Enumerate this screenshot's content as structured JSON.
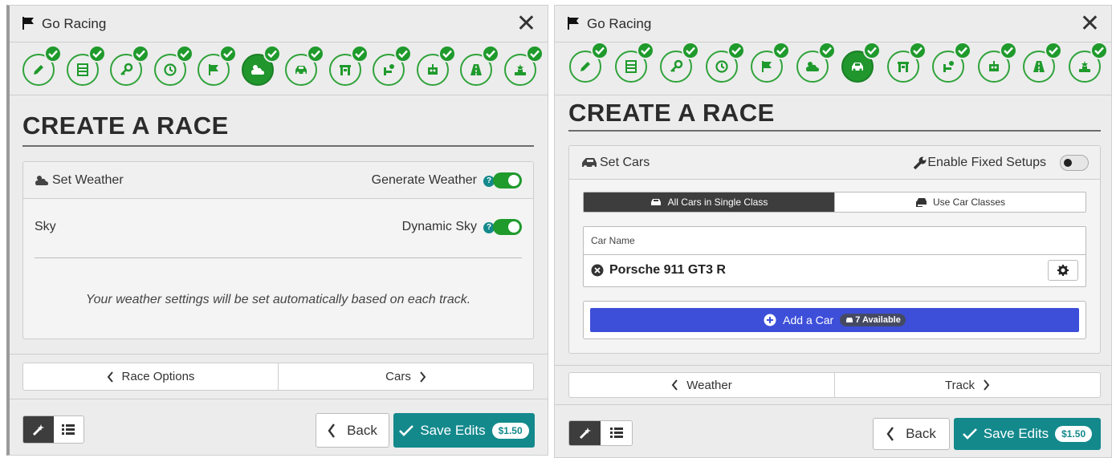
{
  "colors": {
    "accent_green": "#1f9a2c",
    "teal": "#13898c",
    "blue": "#3d4fd9",
    "dark": "#3d3d3d"
  },
  "steps": [
    "edit-icon",
    "list-icon",
    "key-icon",
    "clock-icon",
    "flag-icon",
    "weather-icon",
    "car-icon",
    "track-gate-icon",
    "driver-icon",
    "robot-icon",
    "road-icon",
    "podium-icon"
  ],
  "left": {
    "window_title": "Go Racing",
    "heading": "CREATE A RACE",
    "active_step": 5,
    "weather_card": {
      "title": "Set Weather",
      "generate_label": "Generate Weather",
      "sky_label": "Sky",
      "dynamic_label": "Dynamic Sky",
      "help_glyph": "?",
      "note": "Your weather settings will be set automatically based on each track."
    },
    "nav": {
      "prev_label": "Race Options",
      "next_label": "Cars"
    },
    "footer": {
      "back_label": "Back",
      "save_label": "Save Edits",
      "price": "$1.50"
    }
  },
  "right": {
    "window_title": "Go Racing",
    "heading": "CREATE A RACE",
    "active_step": 6,
    "cars_card": {
      "title": "Set Cars",
      "fixed_label": "Enable Fixed Setups",
      "single_class_label": "All Cars in Single Class",
      "car_classes_label": "Use Car Classes",
      "column_header": "Car Name",
      "cars": [
        "Porsche 911 GT3 R"
      ],
      "add_label": "Add a Car",
      "available": "7 Available"
    },
    "nav": {
      "prev_label": "Weather",
      "next_label": "Track"
    },
    "footer": {
      "back_label": "Back",
      "save_label": "Save Edits",
      "price": "$1.50"
    }
  }
}
